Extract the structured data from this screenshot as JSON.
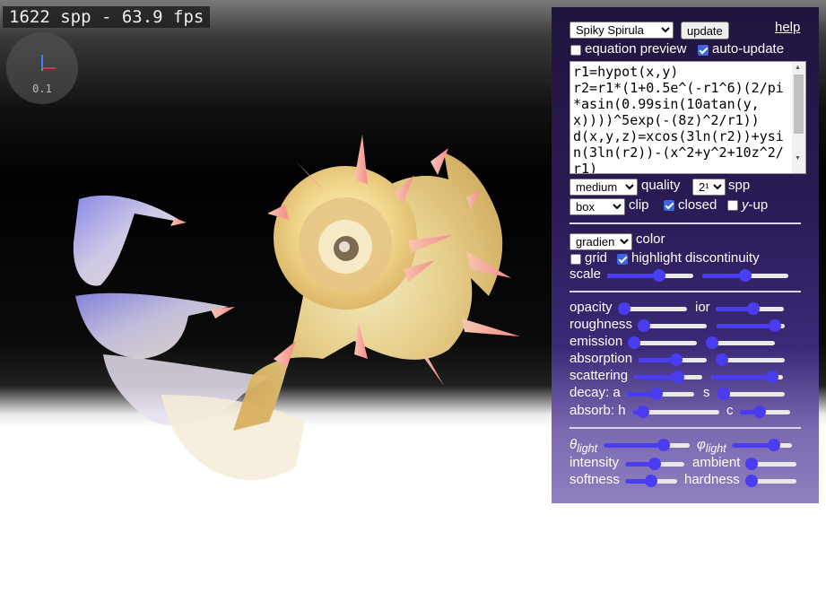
{
  "hud": {
    "fps_text": "1622 spp - 63.9 fps",
    "axes_scale": "0.1"
  },
  "panel": {
    "preset": {
      "selected": "Spiky Spirula"
    },
    "update_label": "update",
    "help_label": "help",
    "equation_preview": {
      "label": "equation preview",
      "checked": false
    },
    "auto_update": {
      "label": "auto-update",
      "checked": true
    },
    "equation": "r1=hypot(x,y)\nr2=r1*(1+0.5e^(-r1^6)(2/pi*asin(0.99sin(10atan(y,x))))^5exp(-(8z)^2/r1))\nd(x,y,z)=xcos(3ln(r2))+ysin(3ln(r2))-(x^2+y^2+10z^2/r1)",
    "quality": {
      "selected": "medium",
      "label": "quality"
    },
    "spp": {
      "selected": "2¹⁴",
      "label": "spp"
    },
    "clip": {
      "selected": "box",
      "label": "clip"
    },
    "closed": {
      "label": "closed",
      "checked": true
    },
    "y_up": {
      "label": "-up",
      "var": "y",
      "checked": false
    },
    "color_mode": {
      "selected": "gradient",
      "label": "color"
    },
    "grid": {
      "label": "grid",
      "checked": false
    },
    "highlight": {
      "label": "highlight discontinuity",
      "checked": true
    },
    "scale": {
      "label": "scale",
      "value1": 0.6,
      "value2": 0.5
    },
    "sliders": {
      "opacity": {
        "label": "opacity",
        "value": 0.0
      },
      "ior": {
        "label": "ior",
        "value": 0.55
      },
      "roughness": {
        "label": "roughness",
        "value": 0.0
      },
      "roughness2": {
        "value": 0.85
      },
      "emission": {
        "label": "emission",
        "value": 0.0
      },
      "emission2": {
        "value": 0.0
      },
      "absorption": {
        "label": "absorption",
        "value": 0.55
      },
      "absorption2": {
        "value": 0.0
      },
      "scattering": {
        "label": "scattering",
        "value": 0.65
      },
      "scattering2": {
        "value": 0.85
      },
      "decay_a": {
        "label": "decay: a",
        "value": 0.45
      },
      "decay_s": {
        "label": "s",
        "value": 0.1
      },
      "absorb_h": {
        "label": "absorb: h",
        "value": 0.12
      },
      "absorb_c": {
        "label": "c",
        "value": 0.4
      },
      "theta_light": {
        "symbol": "θ",
        "sub": "light",
        "value": 0.7
      },
      "phi_light": {
        "symbol": "φ",
        "sub": "light",
        "value": 0.7
      },
      "intensity": {
        "label": "intensity",
        "value": 0.5
      },
      "ambient": {
        "label": "ambient",
        "value": 0.0
      },
      "softness": {
        "label": "softness",
        "value": 0.5
      },
      "hardness": {
        "label": "hardness",
        "value": 0.0
      }
    }
  },
  "colors": {
    "accent": "#4a3cf0",
    "panel_top": "#20153e",
    "panel_bottom": "#8f80c0",
    "shape_gold": "#f3e2a0",
    "shape_blue": "#9a9cf0"
  }
}
